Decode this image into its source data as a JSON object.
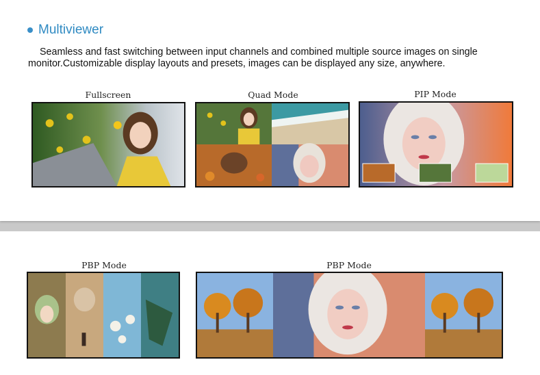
{
  "section": {
    "title": "Multiviewer",
    "description": "Seamless and fast switching between input channels and combined multiple source images on single monitor.Customizable display layouts and presets, images can be displayed any size, anywhere."
  },
  "modes": {
    "fullscreen": "Fullscreen",
    "quad": "Quad Mode",
    "pip": "PIP Mode",
    "pbp1": "PBP Mode",
    "pbp2": "PBP Mode"
  },
  "colors": {
    "accent": "#2f8ac2",
    "frame": "#111111"
  }
}
